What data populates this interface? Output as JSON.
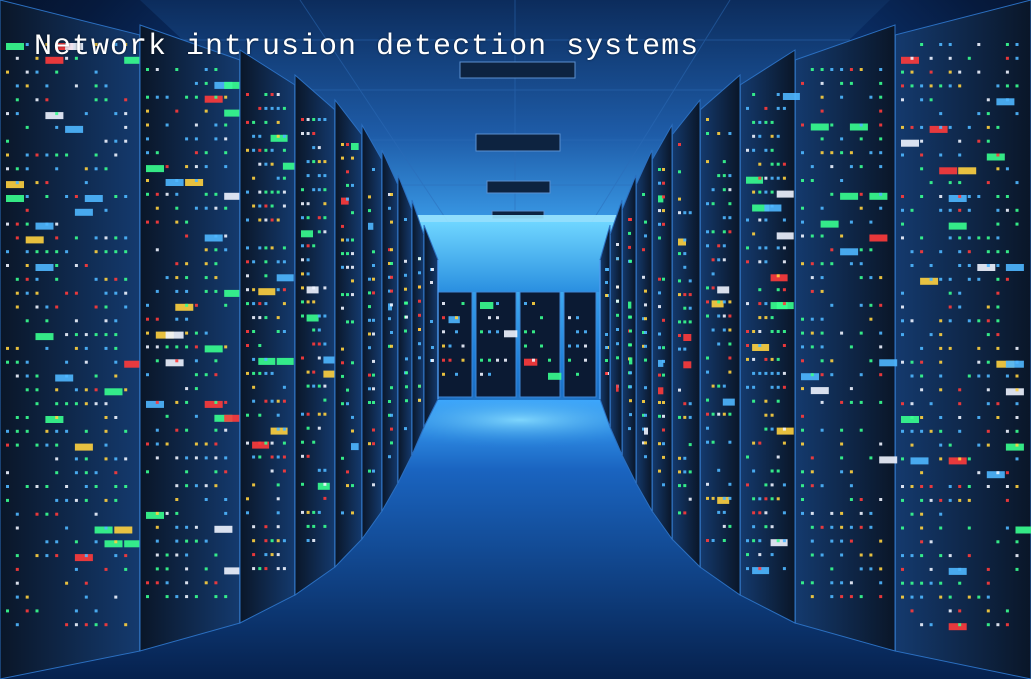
{
  "caption": {
    "title": "Network intrusion detection systems"
  },
  "scene": {
    "description_colors": {
      "ceiling": "#1e5ca8",
      "light_panel": "#5cc8ff",
      "floor": "#0f3f86",
      "rack_body": "#0a1426",
      "led_green": "#39ff8f",
      "led_yellow": "#ffd23f",
      "led_red": "#ff3b3b",
      "led_white": "#f0f4ff",
      "led_blue": "#4fb7ff"
    }
  }
}
